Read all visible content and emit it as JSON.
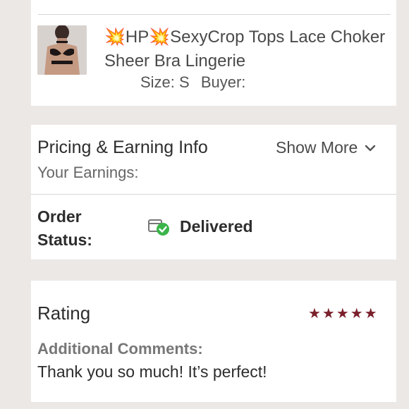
{
  "item": {
    "title": "💥HP💥SexyCrop Tops Lace Choker Sheer Bra Lingerie",
    "size_label": "Size: S",
    "buyer_label": "Buyer:"
  },
  "pricing": {
    "title": "Pricing & Earning Info",
    "show_more": "Show More",
    "earnings_label": "Your Earnings:"
  },
  "order": {
    "status_label": "Order Status:",
    "status_value": "Delivered"
  },
  "rating": {
    "title": "Rating",
    "stars": "★★★★★",
    "value": 5,
    "comments_label": "Additional Comments:",
    "comments_text": "Thank you so much! It’s perfect!"
  },
  "colors": {
    "star": "#7a1f2b",
    "delivered_check": "#3bb54a"
  }
}
